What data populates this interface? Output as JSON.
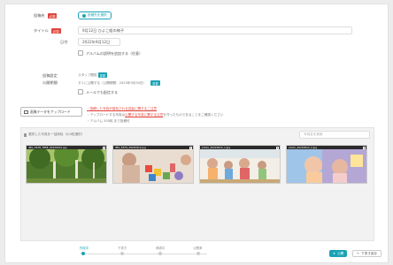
{
  "form": {
    "target_label": "投稿先",
    "required": "必須",
    "select_target_button": "投稿先を選択",
    "title_label": "タイトル",
    "title_value": "9月12日 ひよこ組の様子",
    "date_label": "日付",
    "date_value": "2022年9月12日",
    "add_desc_label": "アルバムの説明を追加する（任意）",
    "publish_setting_label": "投稿設定",
    "publish_date_label": "公開期間",
    "staff_only_text": "スタッフ閲覧",
    "staff_only_badge": "変更",
    "publish_period_text": "すぐに公開する（公開期間：2025年9月30日）",
    "publish_period_badge": "変更",
    "mail_notify_label": "メールでも配信する"
  },
  "upload": {
    "button_label": "画像データをアップロード",
    "note_1": "・投稿した写真が保存される容量に関するご注意",
    "note_2_prefix": "・アップロードする写真は",
    "note_2_link": "公開する写真に関する注意",
    "note_2_suffix": "を守ったものであることをご確認ください",
    "note_3": "・アルバム 200枚 まで投稿可"
  },
  "gallery": {
    "header": "選択した写真を一括削除（0/4枚選択）",
    "search_placeholder": "写真名を検索",
    "photos": [
      {
        "name": "IMG_5678_TREE_20220912.jpg"
      },
      {
        "name": "IMG_5679_20220912.jpg"
      },
      {
        "name": "photo_20220912_1.jpg"
      },
      {
        "name": "photo_20220912_2.jpg"
      }
    ]
  },
  "steps": [
    {
      "label": "作成中"
    },
    {
      "label": "下書き"
    },
    {
      "label": "承認中"
    },
    {
      "label": "公開済"
    }
  ],
  "actions": {
    "publish_label": "公開",
    "draft_label": "下書き保存"
  },
  "colors": {
    "accent": "#1aa3b5",
    "required": "#e0453c"
  }
}
